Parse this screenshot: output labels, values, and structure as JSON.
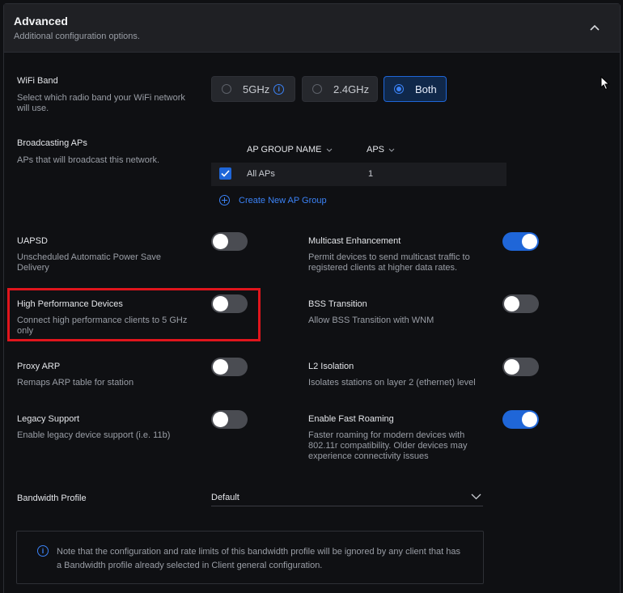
{
  "header": {
    "title": "Advanced",
    "subtitle": "Additional configuration options."
  },
  "wifi_band": {
    "label": "WiFi Band",
    "description": "Select which radio band your WiFi network will use.",
    "options": [
      {
        "label": "5GHz",
        "selected": false,
        "has_info": true
      },
      {
        "label": "2.4GHz",
        "selected": false
      },
      {
        "label": "Both",
        "selected": true
      }
    ]
  },
  "broadcasting": {
    "label": "Broadcasting APs",
    "description": "APs that will broadcast this network.",
    "columns": [
      "AP GROUP NAME",
      "APS"
    ],
    "rows": [
      {
        "name": "All APs",
        "count": "1",
        "checked": true
      }
    ],
    "create_link": "Create New AP Group"
  },
  "settings": {
    "uapsd": {
      "label": "UAPSD",
      "description": "Unscheduled Automatic Power Save Delivery",
      "enabled": false
    },
    "multicast": {
      "label": "Multicast Enhancement",
      "description": "Permit devices to send multicast traffic to registered clients at higher data rates.",
      "enabled": true
    },
    "high_perf": {
      "label": "High Performance Devices",
      "description": "Connect high performance clients to 5 GHz only",
      "enabled": false
    },
    "bss": {
      "label": "BSS Transition",
      "description": "Allow BSS Transition with WNM",
      "enabled": false
    },
    "proxy_arp": {
      "label": "Proxy ARP",
      "description": "Remaps ARP table for station",
      "enabled": false
    },
    "l2": {
      "label": "L2 Isolation",
      "description": "Isolates stations on layer 2 (ethernet) level",
      "enabled": false
    },
    "legacy": {
      "label": "Legacy Support",
      "description": "Enable legacy device support (i.e. 11b)",
      "enabled": false
    },
    "fast_roaming": {
      "label": "Enable Fast Roaming",
      "description": "Faster roaming for modern devices with 802.11r compatibility. Older devices may experience connectivity issues",
      "enabled": true
    }
  },
  "bandwidth": {
    "label": "Bandwidth Profile",
    "value": "Default"
  },
  "note": {
    "text": "Note that the configuration and rate limits of this bandwidth profile will be ignored by any client that has a Bandwidth profile already selected in Client general configuration."
  },
  "colors": {
    "accent": "#1f66d8",
    "highlight": "#e0151c",
    "background": "#0f1013"
  }
}
